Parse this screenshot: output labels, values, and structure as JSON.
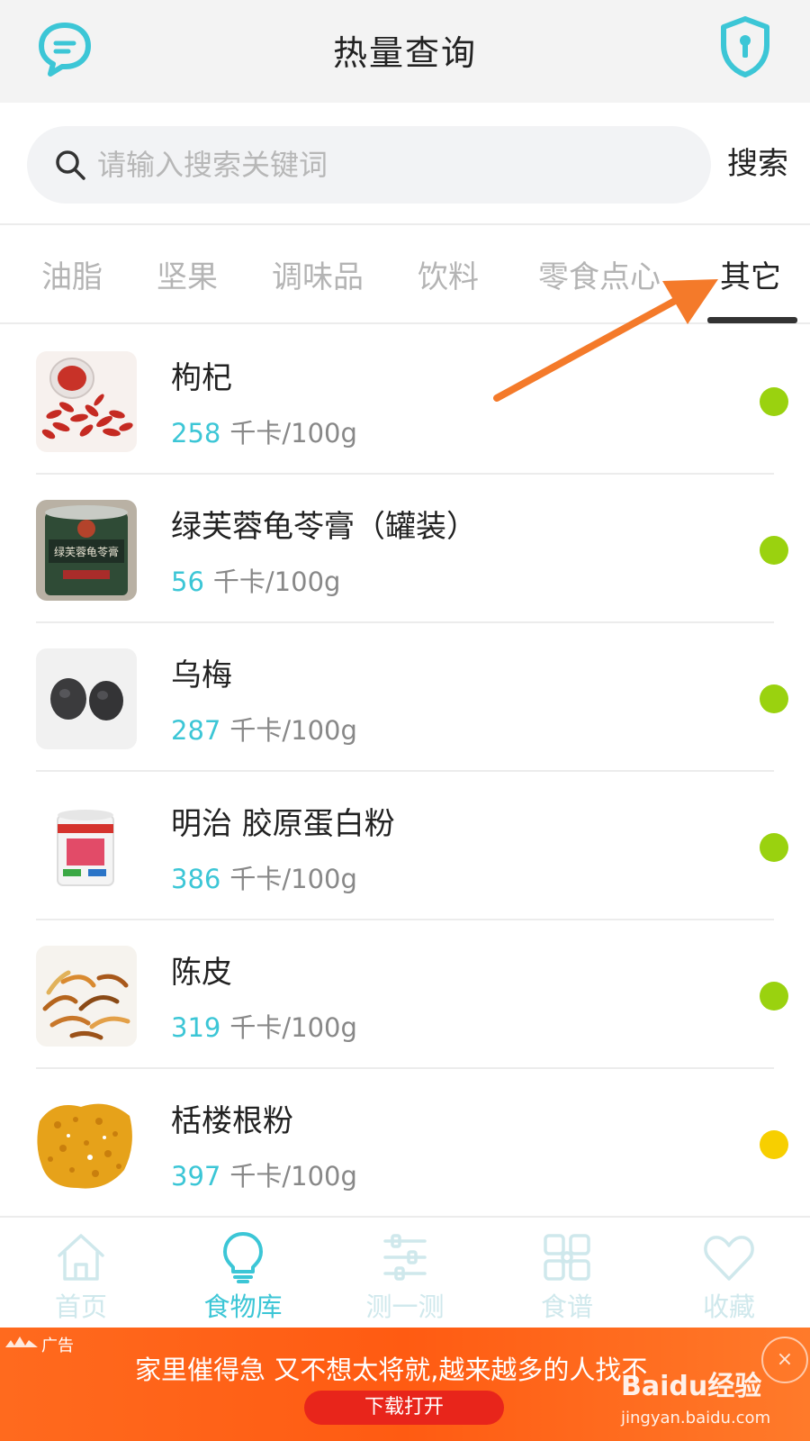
{
  "header": {
    "title": "热量查询",
    "left_icon": "chat-bubble-icon",
    "right_icon": "shield-lock-icon",
    "accent_color": "#3cc6d6"
  },
  "search": {
    "placeholder": "请输入搜索关键词",
    "value": "",
    "button_label": "搜索"
  },
  "tabs": [
    {
      "label": "油脂",
      "active": false
    },
    {
      "label": "坚果",
      "active": false
    },
    {
      "label": "调味品",
      "active": false
    },
    {
      "label": "饮料",
      "active": false
    },
    {
      "label": "零食点心",
      "active": false
    },
    {
      "label": "其它",
      "active": true
    }
  ],
  "foods": [
    {
      "name": "枸杞",
      "calories": "258",
      "unit": "千卡/100g",
      "dot_color": "#9ad20f"
    },
    {
      "name": "绿芙蓉龟苓膏（罐装）",
      "calories": "56",
      "unit": "千卡/100g",
      "dot_color": "#9ad20f"
    },
    {
      "name": "乌梅",
      "calories": "287",
      "unit": "千卡/100g",
      "dot_color": "#9ad20f"
    },
    {
      "name": "明治 胶原蛋白粉",
      "calories": "386",
      "unit": "千卡/100g",
      "dot_color": "#9ad20f"
    },
    {
      "name": "陈皮",
      "calories": "319",
      "unit": "千卡/100g",
      "dot_color": "#9ad20f"
    },
    {
      "name": "栝楼根粉",
      "calories": "397",
      "unit": "千卡/100g",
      "dot_color": "#f7cf00"
    }
  ],
  "bottom_nav": [
    {
      "label": "首页",
      "icon": "home-icon",
      "active": false
    },
    {
      "label": "食物库",
      "icon": "lightbulb-icon",
      "active": true
    },
    {
      "label": "测一测",
      "icon": "sliders-icon",
      "active": false
    },
    {
      "label": "食谱",
      "icon": "grid-icon",
      "active": false
    },
    {
      "label": "收藏",
      "icon": "heart-icon",
      "active": false
    }
  ],
  "ad": {
    "tag": "广告",
    "text": "家里催得急 又不想太将就,越来越多的人找不",
    "button_label": "下载打开",
    "close_symbol": "×"
  },
  "watermark": {
    "main": "Baidu经验",
    "sub": "jingyan.baidu.com"
  },
  "annotation_color": "#f47a2a"
}
